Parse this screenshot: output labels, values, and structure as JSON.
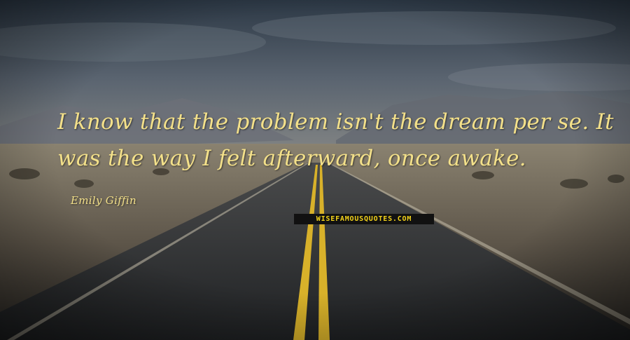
{
  "quote": {
    "lines": [
      "I know that the problem isn't the dream per se. It",
      "was the way I felt afterward, once awake."
    ]
  },
  "author": "Emily Giffin",
  "watermark": "WISEFAMOUSQUOTES.COM",
  "colors": {
    "text": "#f3e08a",
    "watermark_text": "#f2d21a",
    "road_line": "#d8b12a",
    "asphalt": "#2a2c2e"
  }
}
